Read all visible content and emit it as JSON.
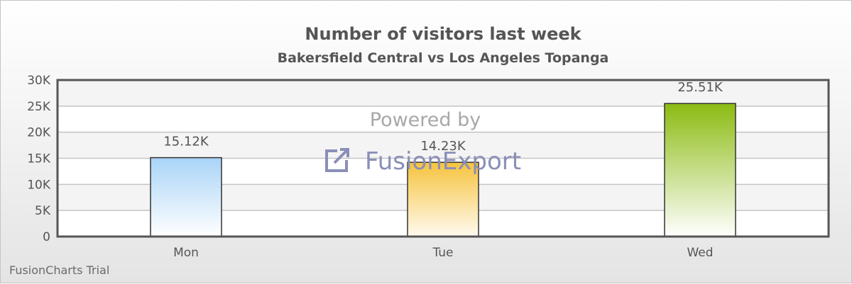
{
  "chart_data": {
    "type": "bar",
    "title": "Number of visitors last week",
    "subtitle": "Bakersfield Central vs Los Angeles Topanga",
    "xlabel": "",
    "ylabel": "",
    "categories": [
      "Mon",
      "Tue",
      "Wed"
    ],
    "values": [
      15123,
      14233,
      25507
    ],
    "value_labels": [
      "15.12K",
      "14.23K",
      "25.51K"
    ],
    "ylim": [
      0,
      30000
    ],
    "y_ticks": [
      {
        "value": 0,
        "label": "0"
      },
      {
        "value": 5000,
        "label": "5K"
      },
      {
        "value": 10000,
        "label": "10K"
      },
      {
        "value": 15000,
        "label": "15K"
      },
      {
        "value": 20000,
        "label": "20K"
      },
      {
        "value": 25000,
        "label": "25K"
      },
      {
        "value": 30000,
        "label": "30K"
      }
    ],
    "grid": true,
    "legend": "none",
    "bar_colors": [
      {
        "top": "#a9d4f7",
        "bottom": "#ffffff"
      },
      {
        "top": "#f6c33d",
        "bottom": "#fffaf0"
      },
      {
        "top": "#8cbb12",
        "bottom": "#ffffff"
      }
    ],
    "colors": {
      "plot_border": "#555555",
      "band_a": "#f4f4f4",
      "band_b": "#ffffff",
      "gridline": "#c4c4c4",
      "bar_border": "#333333"
    }
  },
  "watermark": {
    "line1": "Powered by",
    "brand": "FusionExport",
    "icon": "export-arrow-icon"
  },
  "footer": {
    "trial_text": "FusionCharts Trial"
  }
}
